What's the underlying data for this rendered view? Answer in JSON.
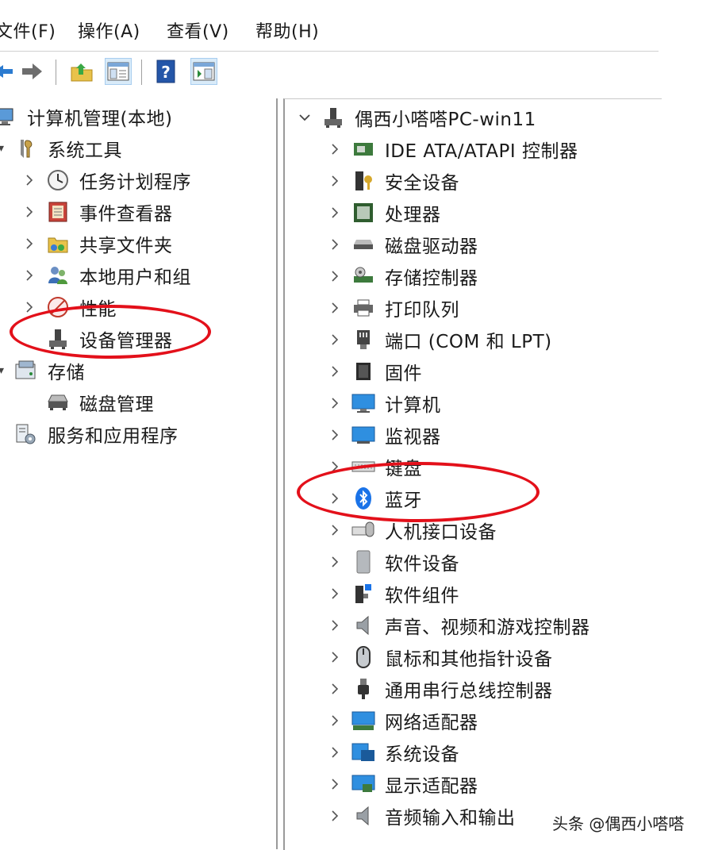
{
  "menubar": {
    "file": "文件(F)",
    "action": "操作(A)",
    "view": "查看(V)",
    "help": "帮助(H)"
  },
  "left_tree": {
    "root": "计算机管理(本地)",
    "system_tools": "系统工具",
    "task_scheduler": "任务计划程序",
    "event_viewer": "事件查看器",
    "shared_folders": "共享文件夹",
    "local_users": "本地用户和组",
    "performance": "性能",
    "device_manager": "设备管理器",
    "storage": "存储",
    "disk_management": "磁盘管理",
    "services_apps": "服务和应用程序"
  },
  "right_tree": {
    "root": "偶西小嗒嗒PC-win11",
    "items": [
      "IDE ATA/ATAPI 控制器",
      "安全设备",
      "处理器",
      "磁盘驱动器",
      "存储控制器",
      "打印队列",
      "端口 (COM 和 LPT)",
      "固件",
      "计算机",
      "监视器",
      "键盘",
      "蓝牙",
      "人机接口设备",
      "软件设备",
      "软件组件",
      "声音、视频和游戏控制器",
      "鼠标和其他指针设备",
      "通用串行总线控制器",
      "网络适配器",
      "系统设备",
      "显示适配器",
      "音频输入和输出"
    ]
  },
  "watermark": "头条 @偶西小嗒嗒",
  "colors": {
    "highlight_circle": "#e3101a",
    "bluetooth": "#1a73e8",
    "monitor": "#2f8fe0"
  }
}
